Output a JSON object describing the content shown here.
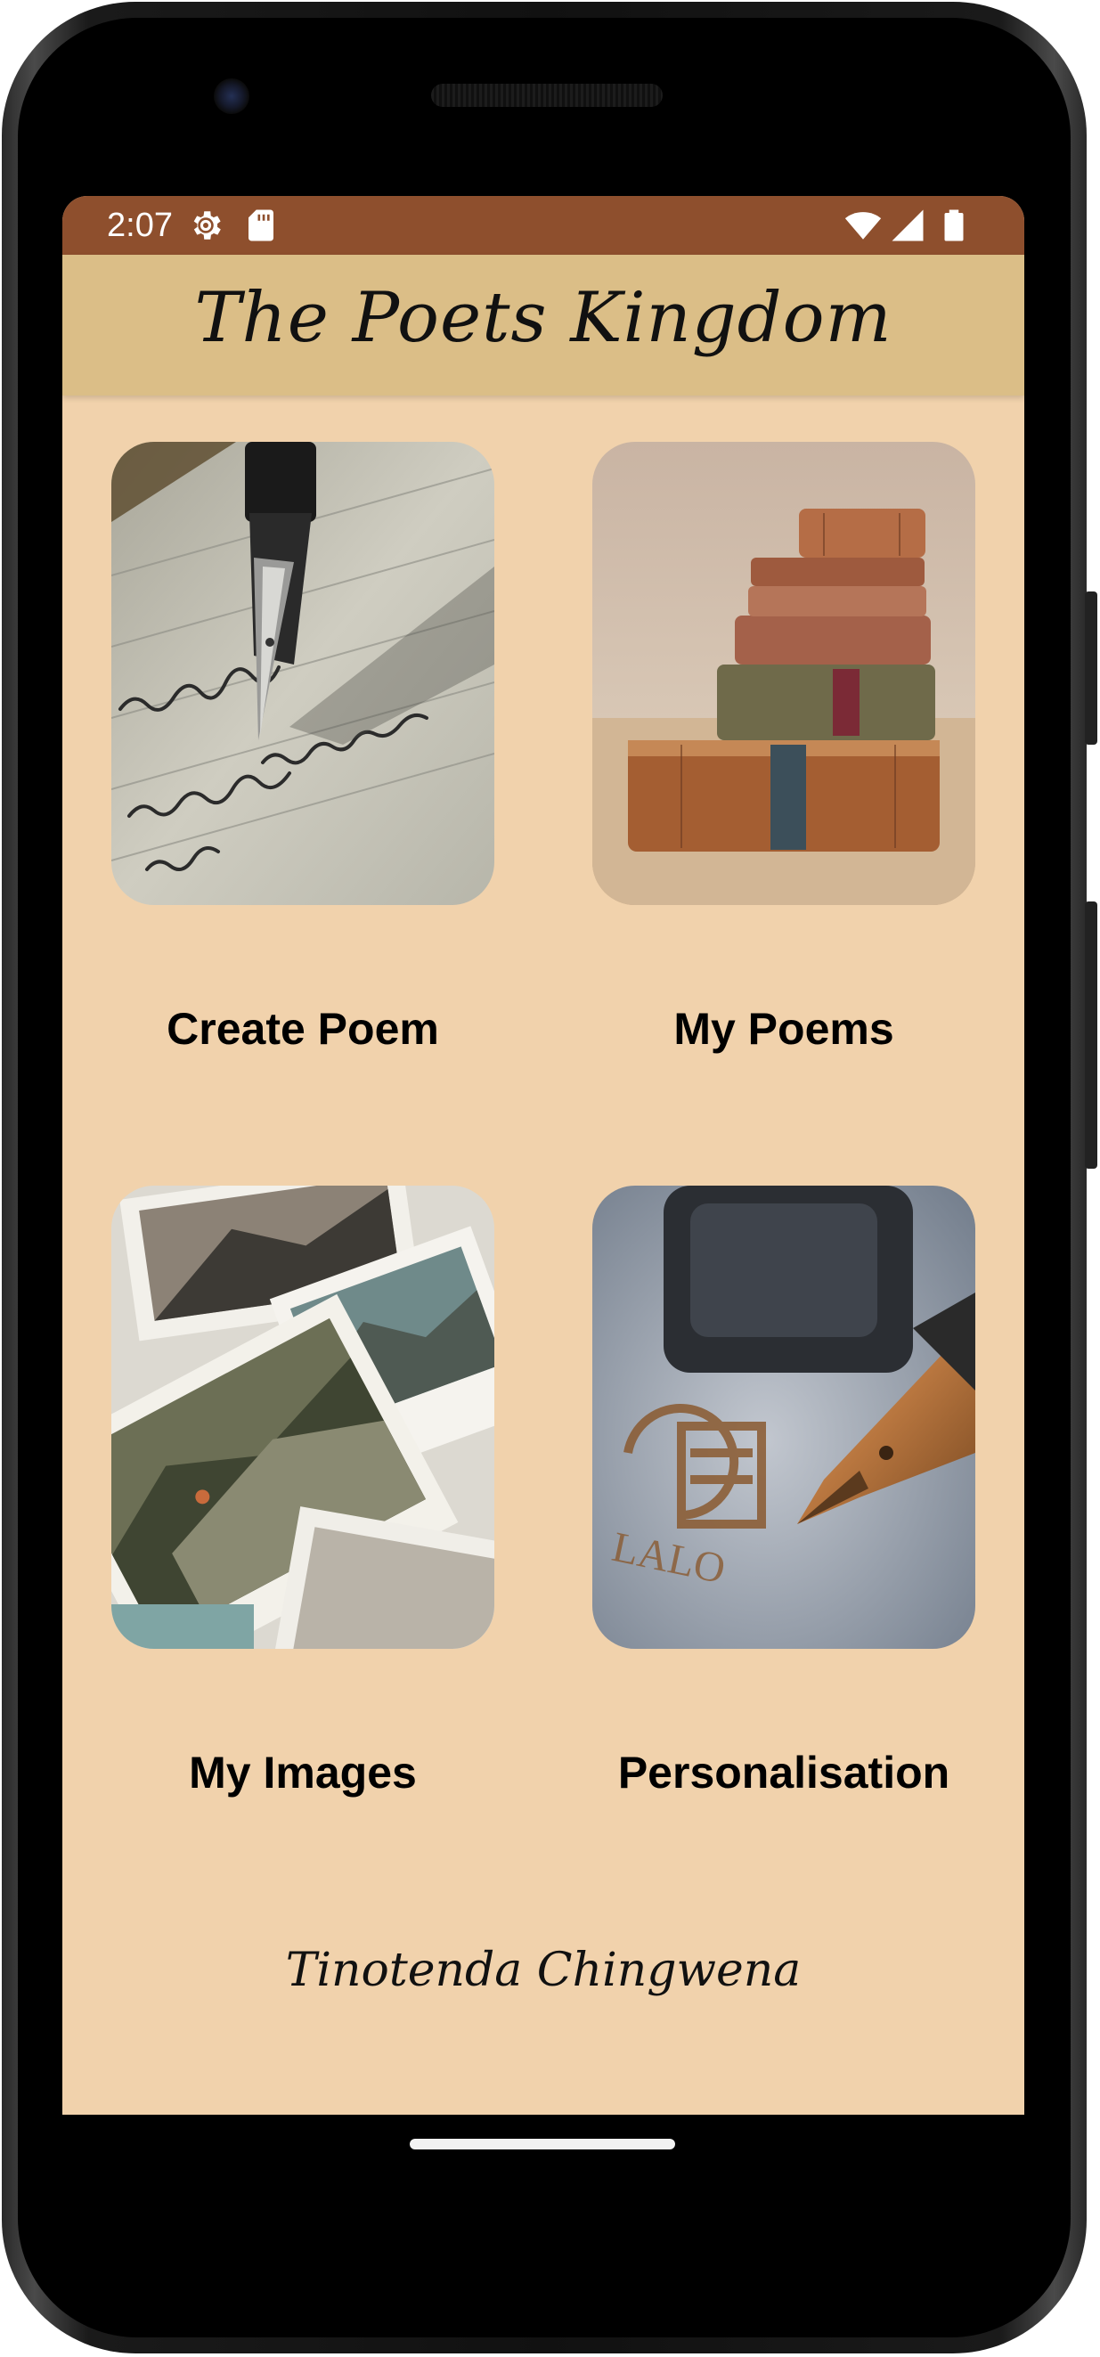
{
  "status_bar": {
    "time": "2:07",
    "icons": [
      "settings-icon",
      "sd-card-icon",
      "wifi-icon",
      "cell-signal-icon",
      "battery-icon"
    ],
    "color": "#8e4f2d"
  },
  "app_bar": {
    "title": "The Poets Kingdom",
    "color": "#dbbe87"
  },
  "tiles": [
    {
      "label": "Create Poem",
      "image": "fountain-pen-writing-image"
    },
    {
      "label": "My Poems",
      "image": "stacked-old-books-image"
    },
    {
      "label": "My Images",
      "image": "scattered-photographs-image"
    },
    {
      "label": "Personalisation",
      "image": "pen-and-ink-stamp-image"
    }
  ],
  "footer": {
    "author": "Tinotenda Chingwena"
  },
  "colors": {
    "background": "#f1d2ac",
    "text": "#000000"
  }
}
